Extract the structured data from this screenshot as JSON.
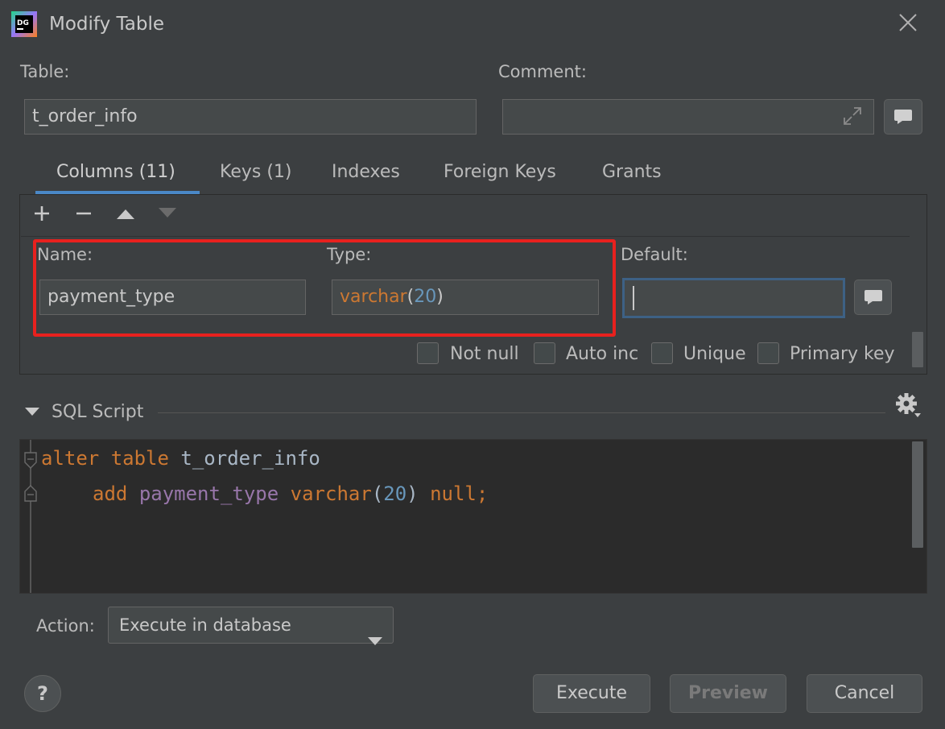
{
  "window": {
    "title": "Modify Table",
    "app_icon": "datagrip-logo-icon",
    "app_icon_text": "DG"
  },
  "table_label": "Table:",
  "table_value": "t_order_info",
  "comment_label": "Comment:",
  "comment_value": "",
  "tabs": [
    {
      "label": "Columns (11)",
      "selected": true
    },
    {
      "label": "Keys (1)"
    },
    {
      "label": "Indexes"
    },
    {
      "label": "Foreign Keys"
    },
    {
      "label": "Grants"
    }
  ],
  "toolbar": {
    "add": "add-icon",
    "remove": "remove-icon",
    "move_up": "arrow-up-icon",
    "move_down": "arrow-down-icon"
  },
  "column_editor": {
    "name_label": "Name:",
    "name_value": "payment_type",
    "type_label": "Type:",
    "type_name": "varchar",
    "type_open": "(",
    "type_size": "20",
    "type_close": ")",
    "default_label": "Default:",
    "default_value": "",
    "checkboxes": [
      {
        "label": "Not null",
        "checked": false
      },
      {
        "label": "Auto inc",
        "checked": false
      },
      {
        "label": "Unique",
        "checked": false
      },
      {
        "label": "Primary key",
        "checked": false
      }
    ]
  },
  "sql": {
    "section_title": "SQL Script",
    "line1_kw": "alter table",
    "line1_name": "t_order_info",
    "line2_kw": "add",
    "line2_col": "payment_type",
    "line2_type": "varchar",
    "line2_open": "(",
    "line2_num": "20",
    "line2_close": ")",
    "line2_null": "null;"
  },
  "action": {
    "label": "Action:",
    "selected": "Execute in database"
  },
  "buttons": {
    "help": "?",
    "execute": "Execute",
    "preview": "Preview",
    "cancel": "Cancel"
  },
  "colors": {
    "accent": "#4a88c7",
    "highlight": "#e8211e",
    "keyword": "#cc7832",
    "number": "#6897bb",
    "column": "#9876aa"
  }
}
